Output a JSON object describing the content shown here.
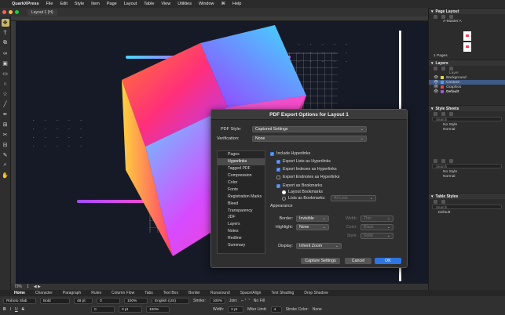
{
  "menubar": {
    "app": "QuarkXPress",
    "items": [
      "File",
      "Edit",
      "Style",
      "Item",
      "Page",
      "Layout",
      "Table",
      "View",
      "Utilities",
      "Window",
      "Help"
    ]
  },
  "document": {
    "tab": "Layout 1 (H)"
  },
  "status": {
    "zoom": "73%",
    "page": "1"
  },
  "panels": {
    "page_layout": {
      "title": "Page Layout",
      "master": "A-Master A",
      "pages_label": "1 Pages"
    },
    "layers": {
      "title": "Layers",
      "col": "Layer",
      "items": [
        "Background",
        "Content",
        "Graphics",
        "Default"
      ],
      "colors": [
        "#e6d24a",
        "#4f9cf0",
        "#e04a4a",
        "#9b59d0"
      ]
    },
    "style_sheets": {
      "title": "Style Sheets",
      "search": "Search",
      "para": [
        "No Style",
        "Normal"
      ],
      "char": [
        "No Style",
        "Normal"
      ]
    },
    "table_styles": {
      "title": "Table Styles",
      "search": "Search",
      "items": [
        "Default"
      ]
    }
  },
  "measure_tabs": [
    "Home",
    "Character",
    "Paragraph",
    "Rules",
    "Column Flow",
    "Tabs",
    "Text Box",
    "Border",
    "Runaround",
    "Space/Align",
    "Text Shading",
    "Drop Shadow"
  ],
  "measure": {
    "font": "Roboto Slab",
    "style": "Bold",
    "size": "48 pt",
    "tracking": "0",
    "kern": "0",
    "scale_h": "100%",
    "scale_v": "100%",
    "lang": "English (US)",
    "stroke_label": "Stroke:",
    "stroke": "100%",
    "width_label": "Width:",
    "width": "2 pt",
    "join_label": "Join:",
    "miter_label": "Miter Limit:",
    "miter": "4",
    "fill": "No Fill",
    "stroke_color_label": "Stroke Color:",
    "none": "None",
    "baseline": "0 pt"
  },
  "dialog": {
    "title": "PDF Export Options for Layout 1",
    "pdf_style_label": "PDF Style:",
    "pdf_style": "Captured Settings",
    "verification_label": "Verification:",
    "verification": "None",
    "nav": [
      "Pages",
      "Hyperlinks",
      "Tagged PDF",
      "Compression",
      "Color",
      "Fonts",
      "Registration Marks",
      "Bleed",
      "Transparency",
      "JDF",
      "Layers",
      "Notes",
      "Redline",
      "Summary"
    ],
    "active_nav": "Hyperlinks",
    "include_hyperlinks": "Include Hyperlinks",
    "export_lists": "Export Lists as Hyperlinks",
    "export_indexes": "Export Indexes as Hyperlinks",
    "export_endnotes": "Export Endnotes as Hyperlinks",
    "export_bookmarks": "Export as Bookmarks",
    "layout_bookmarks": "Layout Bookmarks",
    "lists_bookmarks": "Lists as Bookmarks:",
    "lists_value": "All Lists",
    "appearance": "Appearance",
    "border_label": "Border:",
    "border": "Invisible",
    "width_label": "Width:",
    "width": "Thin",
    "highlight_label": "Highlight:",
    "highlight": "None",
    "color_label": "Color:",
    "color": "Black",
    "style_label": "Style:",
    "style": "Solid",
    "display_label": "Display:",
    "display": "Inherit Zoom",
    "capture_btn": "Capture Settings",
    "cancel_btn": "Cancel",
    "ok_btn": "OK"
  }
}
